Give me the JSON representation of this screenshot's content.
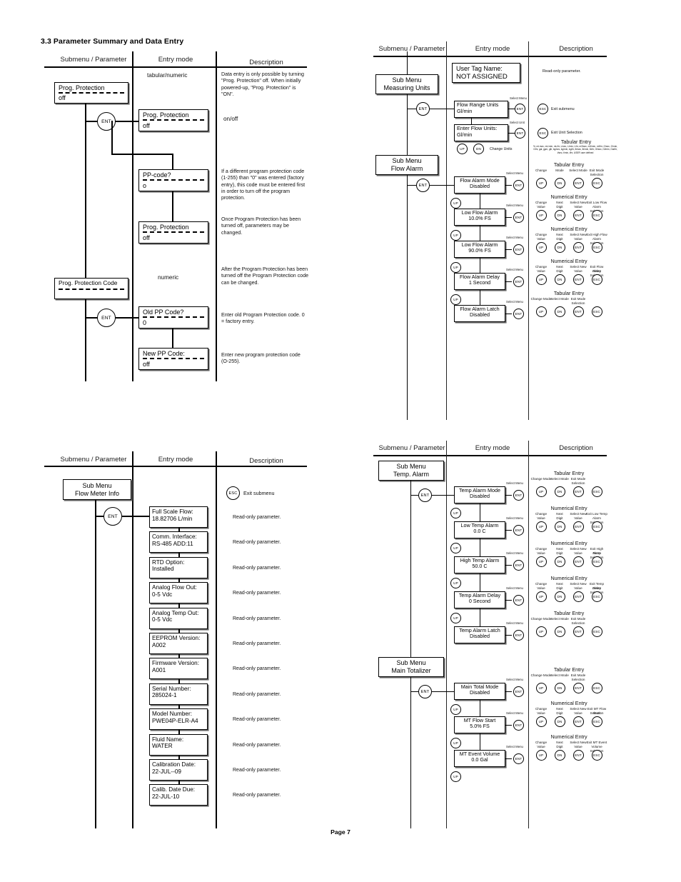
{
  "section": {
    "number_title": "3.3 Parameter Summary and Data Entry"
  },
  "footer": {
    "page_label": "Page 7"
  },
  "columns": {
    "submenu": "Submenu / Parameter",
    "entry_mode": "Entry mode",
    "description": "Description"
  },
  "keys": {
    "ent": "ENT",
    "esc": "ESC",
    "up": "UP",
    "dn": "DN"
  },
  "quadrant_top_left": {
    "entry_mode_labels": {
      "tabular_numeric": "tabular/numeric",
      "onoff": "on/off",
      "numeric": "numeric"
    },
    "boxes": {
      "prog_protection_param": {
        "line1": "Prog. Protection",
        "line2": "off"
      },
      "prog_protection_entry": {
        "line1": "Prog. Protection",
        "line2": "off"
      },
      "pp_code": {
        "line1": "PP-code?",
        "line2": "o"
      },
      "prog_protection_after": {
        "line1": "Prog. Protection",
        "line2": "off"
      },
      "prog_protection_code_param": {
        "line1": "Prog. Protection Code",
        "line2": ""
      },
      "old_pp_code": {
        "line1": "Old PP Code?",
        "line2": "0"
      },
      "new_pp_code": {
        "line1": "New PP Code:",
        "line2": "off"
      }
    },
    "descriptions": {
      "d1": "Data entry is only possible by turning \"Prog. Protection\" off. When initially powered-up, \"Prog. Protection\" is \"ON\".",
      "d2": "If a different program protection code (1-255) than \"0\" was entered (factory entry), this code must be entered first in order to turn off the program protection.",
      "d3": "Once Program Protection has been turned off, parameters may be changed.",
      "d4": "After the Program Protection has been turned off the Program Protection code can be changed.",
      "d5": "Enter old Program Protection code. 0 = factory entry.",
      "d6": "Enter new program protection code (O-255)."
    }
  },
  "quadrant_bottom_left": {
    "submenu_box": {
      "line1": "Sub Menu",
      "line2": "Flow Meter Info"
    },
    "exit_submenu": "Exit submenu",
    "readonly_label": "Read-only parameter.",
    "info_boxes": [
      {
        "line1": "Full Scale Flow:",
        "line2": "18.82706 L/min"
      },
      {
        "line1": "Comm. Interface:",
        "line2": "RS-485   ADD:11"
      },
      {
        "line1": "RTD Option:",
        "line2": "Installed"
      },
      {
        "line1": "Analog Flow Out:",
        "line2": "0-5 Vdc"
      },
      {
        "line1": "Analog Temp Out:",
        "line2": "0-5 Vdc"
      },
      {
        "line1": "EEPROM Version:",
        "line2": "A002"
      },
      {
        "line1": "Firmware Version:",
        "line2": "A001"
      },
      {
        "line1": "Serial Number:",
        "line2": "285024-1"
      },
      {
        "line1": "Model Number:",
        "line2": "PWE04P-ELR-A4"
      },
      {
        "line1": "Fluid Name:",
        "line2": "WATER"
      },
      {
        "line1": "Calibration Date:",
        "line2": "22-JUL--09"
      },
      {
        "line1": "Calib. Date Due:",
        "line2": "22-JUL-10"
      }
    ]
  },
  "quadrant_top_right": {
    "user_tag": {
      "line1": "User Tag Name:",
      "line2": "NOT ASSIGNED"
    },
    "user_tag_desc": "Read-only parameter.",
    "measuring_units": {
      "submenu_box": {
        "line1": "Sub Menu",
        "line2": "Measuring Units"
      },
      "flow_range_units": {
        "line1": "Flow Range Units",
        "line2": "Gl/min"
      },
      "enter_flow_units": {
        "line1": "Enter Flow Units:",
        "line2": "Gl/min"
      },
      "select_menu": "Select Menu",
      "select_unit": "Select Unit",
      "change_units": "Change Units",
      "exit_submenu": "Exit submenu",
      "exit_unit_selection": "Exit Unit Selection",
      "tabular_entry_title": "Tabular Entry",
      "unit_list": "%, mL/sec, mL/min, mL/hr, L/sec, L/min, L/hr, m3/sec, m3/min, m3/hr, G/sec, G/min, G/hr, gal, gpm, glh, kg/sec, kg/min, kg/hr, lb/sec, lb/min, lb/hr, Gl/sec, Gl/min, Gal/hr, t/sec, t/min, t/hr, USER user defined"
    },
    "flow_alarm": {
      "submenu_box": {
        "line1": "Sub Menu",
        "line2": "Flow Alarm"
      },
      "rows": [
        {
          "box": {
            "line1": "Flow Alarm Mode",
            "line2": "Disabled"
          },
          "select_menu": "Select Menu",
          "entry_title": "Tabular Entry",
          "labels": [
            "Change",
            "Mode",
            "Select Mode",
            "Exit Mode"
          ],
          "labels2": [
            "",
            "",
            "",
            "Selection"
          ],
          "keys": [
            "UP",
            "DN",
            "ENT",
            "ESC"
          ]
        },
        {
          "box": {
            "line1": "Low Flow Alarm",
            "line2": "10.0% FS"
          },
          "select_menu": "Select Menu",
          "entry_title": "Numerical Entry",
          "labels": [
            "Change",
            "Next",
            "Select New",
            "Exit Low Flow"
          ],
          "labels2": [
            "Value",
            "Digit",
            "Value",
            "Alarm Selection"
          ],
          "keys": [
            "UP",
            "DN",
            "ENT",
            "ESC"
          ]
        },
        {
          "box": {
            "line1": "Low Flow Alarm",
            "line2": "90.0% FS"
          },
          "select_menu": "Select Menu",
          "entry_title": "Numerical Entry",
          "labels": [
            "Change",
            "Next",
            "Select New",
            "Exit High Flow"
          ],
          "labels2": [
            "Value",
            "Digit",
            "Value",
            "Alarm Selection"
          ],
          "keys": [
            "UP",
            "DN",
            "ENT",
            "ESC"
          ]
        },
        {
          "box": {
            "line1": "Flow Alarm Delay",
            "line2": "1 Second"
          },
          "select_menu": "Select Menu",
          "entry_title": "Numerical Entry",
          "labels": [
            "Change",
            "Next",
            "Select New",
            "Exit Flow Alarm"
          ],
          "labels2": [
            "Value",
            "Digit",
            "Value",
            "Delay Selection"
          ],
          "keys": [
            "UP",
            "DN",
            "ENT",
            "ESC"
          ]
        },
        {
          "box": {
            "line1": "Flow Alarm Latch",
            "line2": "Disabled"
          },
          "select_menu": "Select Menu",
          "entry_title": "Tabular Entry",
          "labels": [
            "Change Mode",
            "Select Mode",
            "Exit Mode"
          ],
          "labels2": [
            "",
            "",
            "Selection"
          ],
          "keys": [
            "UP",
            "DN",
            "ENT",
            "ESC"
          ]
        }
      ]
    }
  },
  "quadrant_bottom_right": {
    "temp_alarm": {
      "submenu_box": {
        "line1": "Sub Menu",
        "line2": "Temp. Alarm"
      },
      "rows": [
        {
          "box": {
            "line1": "Temp Alarm Mode",
            "line2": "Disabled"
          },
          "select_menu": "Select Menu",
          "entry_title": "Tabular Entry",
          "labels": [
            "Change Mode",
            "Select Mode",
            "Exit Mode"
          ],
          "labels2": [
            "",
            "",
            "Selection"
          ],
          "keys": [
            "UP",
            "DN",
            "ENT",
            "ESC"
          ]
        },
        {
          "box": {
            "line1": "Low Temp Alarm",
            "line2": "0.0 C"
          },
          "select_menu": "Select Menu",
          "entry_title": "Numerical Entry",
          "labels": [
            "Change",
            "Next",
            "Select New",
            "Exit Low Temp"
          ],
          "labels2": [
            "Value",
            "Digit",
            "Value",
            "Alarm Selection"
          ],
          "keys": [
            "UP",
            "DN",
            "ENT",
            "ESC"
          ]
        },
        {
          "box": {
            "line1": "High Temp Alarm",
            "line2": "50.0 C"
          },
          "select_menu": "Select Menu",
          "entry_title": "Numerical Entry",
          "labels": [
            "Change",
            "Next",
            "Select New",
            "Exit High Temp"
          ],
          "labels2": [
            "Value",
            "Digit",
            "Value",
            "Alarm Selection"
          ],
          "keys": [
            "UP",
            "DN",
            "ENT",
            "ESC"
          ]
        },
        {
          "box": {
            "line1": "Temp Alarm Delay",
            "line2": "0 Second"
          },
          "select_menu": "Select Menu",
          "entry_title": "Numerical Entry",
          "labels": [
            "Change",
            "Next",
            "Select New",
            "Exit Temp Alarm"
          ],
          "labels2": [
            "Value",
            "Digit",
            "Value",
            "Delay Selection"
          ],
          "keys": [
            "UP",
            "DN",
            "ENT",
            "ESC"
          ]
        },
        {
          "box": {
            "line1": "Temp Alarm Latch",
            "line2": "Disabled"
          },
          "select_menu": "Select Menu",
          "entry_title": "Tabular Entry",
          "labels": [
            "Change Mode",
            "Select Mode",
            "Exit Mode"
          ],
          "labels2": [
            "",
            "",
            "Selection"
          ],
          "keys": [
            "UP",
            "DN",
            "ENT",
            "ESC"
          ]
        }
      ]
    },
    "main_totalizer": {
      "submenu_box": {
        "line1": "Sub Menu",
        "line2": "Main Totalizer"
      },
      "rows": [
        {
          "box": {
            "line1": "Main Total Mode",
            "line2": "Disabled"
          },
          "select_menu": "Select Menu",
          "entry_title": "Tabular Entry",
          "labels": [
            "Change Mode",
            "Select Mode",
            "Exit Mode"
          ],
          "labels2": [
            "",
            "",
            "Selection"
          ],
          "keys": [
            "UP",
            "DN",
            "ENT",
            "ESC"
          ]
        },
        {
          "box": {
            "line1": "MT Flow Start",
            "line2": "5.0% FS"
          },
          "select_menu": "Select Menu",
          "entry_title": "Numerical Entry",
          "labels": [
            "Change",
            "Next",
            "Select New",
            "Exit MT Flow Start"
          ],
          "labels2": [
            "Value",
            "Digit",
            "Value",
            "Selection"
          ],
          "keys": [
            "UP",
            "DN",
            "ENT",
            "ESC"
          ]
        },
        {
          "box": {
            "line1": "MT Event Volume",
            "line2": "0.0 Gal"
          },
          "select_menu": "Select Menu",
          "entry_title": "Numerical Entry",
          "labels": [
            "Change",
            "Next",
            "Select New",
            "Exit MT Event"
          ],
          "labels2": [
            "Value",
            "Digit",
            "Value",
            "Volume Selection"
          ],
          "keys": [
            "UP",
            "DN",
            "ENT",
            "ESC"
          ]
        }
      ]
    }
  }
}
